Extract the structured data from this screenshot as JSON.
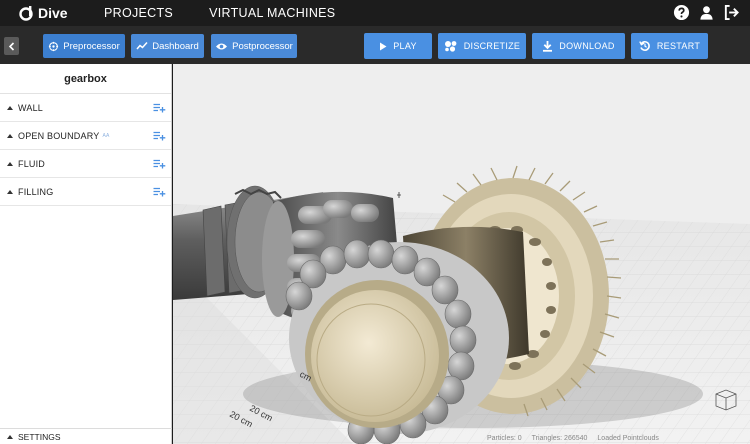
{
  "app": {
    "name": "Dive"
  },
  "topnav": {
    "projects": "PROJECTS",
    "virtual_machines": "VIRTUAL MACHINES"
  },
  "modes": {
    "preprocessor": "Preprocessor",
    "dashboard": "Dashboard",
    "postprocessor": "Postprocessor"
  },
  "actions": {
    "play": "PLAY",
    "discretize": "DISCRETIZE",
    "download": "DOWNLOAD",
    "restart": "RESTART"
  },
  "sidebar": {
    "project": "gearbox",
    "items": [
      {
        "label": "WALL"
      },
      {
        "label": "OPEN BOUNDARY",
        "badge": "AA"
      },
      {
        "label": "FLUID"
      },
      {
        "label": "FILLING"
      }
    ],
    "settings": "SETTINGS"
  },
  "viewport": {
    "ruler_label_1": "20 cm",
    "ruler_label_2": "20 cm",
    "ruler_label_3": "cm",
    "status": {
      "particles": "Particles: 0",
      "triangles": "Triangles: 266540",
      "loaded": "Loaded Pointclouds"
    }
  },
  "colors": {
    "accent": "#4a90e2",
    "topbar": "#1c1c1c",
    "toolbar": "#2a2a2a"
  }
}
